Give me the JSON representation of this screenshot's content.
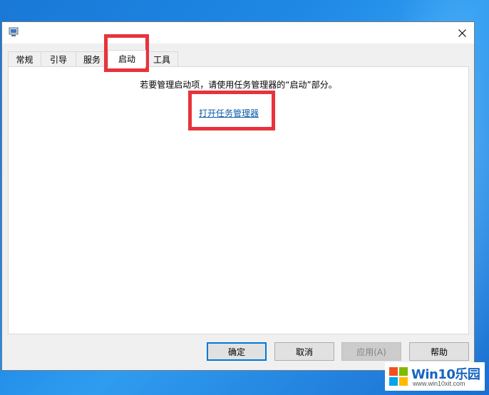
{
  "tabs": [
    {
      "label": "常规",
      "active": false
    },
    {
      "label": "引导",
      "active": false
    },
    {
      "label": "服务",
      "active": false
    },
    {
      "label": "启动",
      "active": true
    },
    {
      "label": "工具",
      "active": false
    }
  ],
  "panel": {
    "message": "若要管理启动项，请使用任务管理器的“启动”部分。",
    "link": "打开任务管理器"
  },
  "buttons": {
    "ok": "确定",
    "cancel": "取消",
    "apply": "应用(A)",
    "help": "帮助"
  },
  "watermark": {
    "title": "Win10乐园",
    "url": "www.win10xit.com"
  },
  "colors": {
    "highlight": "#e8333c",
    "link": "#0a5aa8",
    "desktop": "#1e88e5"
  }
}
